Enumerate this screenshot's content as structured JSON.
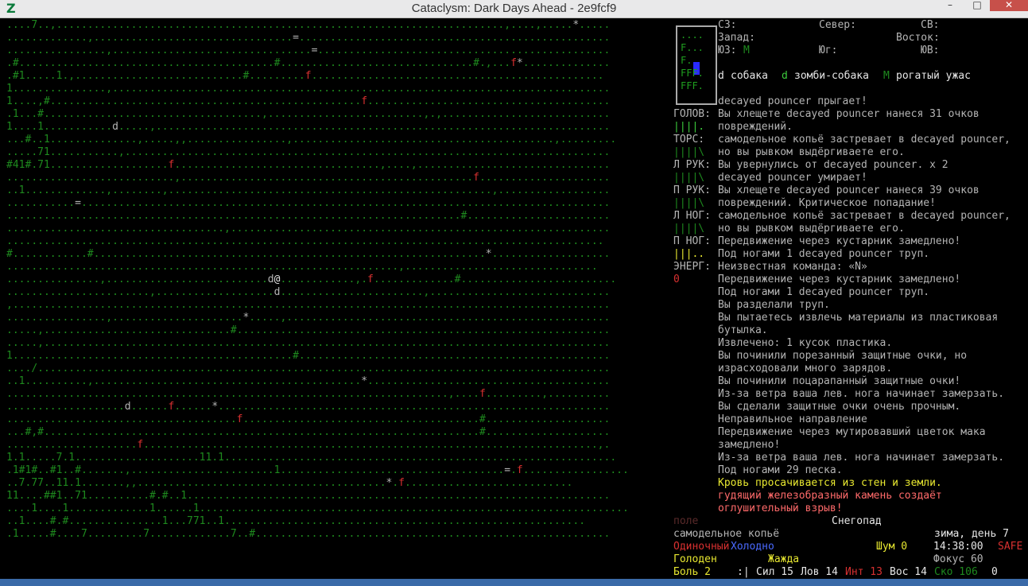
{
  "window": {
    "title": "Cataclysm: Dark Days Ahead - 2e9fcf9",
    "icon": "Z",
    "min": "–",
    "max": "□",
    "close": "✕"
  },
  "colors": {
    "dots": "#1e8a1e",
    "bright_green": "#3ccc3c",
    "red": "#d83030",
    "white": "#e6e6e6",
    "gray": "#b4b4b4",
    "yellow": "#e8e830",
    "blue": "#2a2aff",
    "pink": "#c86464"
  },
  "map": {
    "rows": [
      "....7..,........................................................................,....,.....*.....",
      ".............,................................=..................................................",
      "................,................................=...............................................",
      ".#.........................................#...............................#.,...f*..............",
      ".#1.....1.,...........................#.........f...............................................",
      "1...............,................................................................................",
      "1....,#..................................................f.......................................",
      ".1...#...................................,.........................,.,...........................",
      "1....1...........d.....,.........................................................................",
      "...#..1..............,.....,,................,..........................................,.........",
      ".....71...........,..............................................................................",
      "#41#.71...................f.................................,....,...............................",
      "...........................,...............................................f.....................",
      "..1.............,........,....................................................,..................",
      "...........=.....................................................................................",
      ".........................................................................#.......................",
      "...................................,.............................................................",
      "................................................................................................",
      "#............#...............................................................*...................",
      "...............................................................,...............................",
      "...............,..........................d@............,.f.............#.........................",
      ".......................,...................d.......................,.............................",
      ",................................................................................................",
      "................,.....................*.....,....................................................",
      ".....,..............................#............................................................",
      ".....,...........................................................................................",
      "1.............................................#..................................................",
      "..../............................................................................................",
      "..1..........,...........................................*.......................................",
      ".......................................................................,....f.........,..........",
      "...................d......f......*...............................................................",
      ".....................................f......................................#....................",
      "...#,#......................................................................#....................",
      ".....................f.........................................................................,.",
      "1.1.....7.1....................11.1...............................................................",
      ".1#1#..#1..#.......,.......................1....................................=.f.................",
      "..7.77..11.1.......,,........................................*.f...........................",
      "11....##1..71..........#.#..1....................................................................",
      "....1....1.............1......1.....................................................................",
      "..1....#.#...............1...771..1..........................................................",
      ".1.....#....7.........7.............7..#........................................................."
    ]
  },
  "minimap": {
    "rows": [
      "....",
      "F...",
      "F.",
      "FFF.",
      "FFF."
    ]
  },
  "compass": {
    "nw": "СЗ:",
    "n": "Север:",
    "ne": "СВ:",
    "w": "Запад:",
    "e": "Восток:",
    "sw": "ЮЗ:",
    "sw_val": "M",
    "s": "Юг:",
    "se": "ЮВ:"
  },
  "legend": [
    {
      "glyph": "d",
      "label": "собака",
      "color": "#e6e6e6"
    },
    {
      "glyph": "d",
      "label": "зомби-собака",
      "color": "#3ccc3c"
    },
    {
      "glyph": "M",
      "label": "рогатый ужас",
      "color": "#1e8a1e"
    }
  ],
  "body": [
    {
      "label": "ГОЛОВ:",
      "bar": "||||.",
      "color": "#3ccc3c"
    },
    {
      "label": "ТОРС:",
      "bar": "||||\\",
      "color": "#1e8a1e"
    },
    {
      "label": "Л РУК:",
      "bar": "||||\\",
      "color": "#1e8a1e"
    },
    {
      "label": "П РУК:",
      "bar": "||||\\",
      "color": "#1e8a1e"
    },
    {
      "label": "Л НОГ:",
      "bar": "||||\\",
      "color": "#1e8a1e"
    },
    {
      "label": "П НОГ:",
      "bar": "|||..",
      "color": "#e8e830"
    },
    {
      "label": "ЭНЕРГ:",
      "bar": "0",
      "color": "#d83030"
    }
  ],
  "log": [
    {
      "text": "decayed pouncer прыгает!",
      "color": "#b4b4b4"
    },
    {
      "text": "Вы хлещете decayed pouncer нанеся 31 очков",
      "color": "#b4b4b4"
    },
    {
      "text": "повреждений.",
      "color": "#b4b4b4"
    },
    {
      "text": "самодельное копьё застревает в decayed pouncer,",
      "color": "#b4b4b4"
    },
    {
      "text": "но вы рывком выдёргиваете его.",
      "color": "#b4b4b4"
    },
    {
      "text": "Вы увернулись от decayed pouncer. x 2",
      "color": "#b4b4b4"
    },
    {
      "text": "decayed pouncer умирает!",
      "color": "#b4b4b4"
    },
    {
      "text": "Вы хлещете decayed pouncer нанеся 39 очков",
      "color": "#b4b4b4"
    },
    {
      "text": "повреждений. Критическое попадание!",
      "color": "#b4b4b4"
    },
    {
      "text": "самодельное копьё застревает в decayed pouncer,",
      "color": "#b4b4b4"
    },
    {
      "text": "но вы рывком выдёргиваете его.",
      "color": "#b4b4b4"
    },
    {
      "text": "Передвижение через кустарник замедлено!",
      "color": "#b4b4b4"
    },
    {
      "text": "Под ногами 1 decayed pouncer труп.",
      "color": "#b4b4b4"
    },
    {
      "text": "Неизвестная команда: «N»",
      "color": "#b4b4b4"
    },
    {
      "text": "Передвижение через кустарник замедлено!",
      "color": "#b4b4b4"
    },
    {
      "text": "Под ногами 1 decayed pouncer труп.",
      "color": "#b4b4b4"
    },
    {
      "text": "Вы разделали труп.",
      "color": "#b4b4b4"
    },
    {
      "text": "Вы пытаетесь извлечь материалы из пластиковая",
      "color": "#b4b4b4"
    },
    {
      "text": "бутылка.",
      "color": "#b4b4b4"
    },
    {
      "text": "Извлечено: 1 кусок пластика.",
      "color": "#b4b4b4"
    },
    {
      "text": "Вы починили порезанный защитные очки, но",
      "color": "#b4b4b4"
    },
    {
      "text": "израсходовали много зарядов.",
      "color": "#b4b4b4"
    },
    {
      "text": "Вы починили поцарапанный защитные очки!",
      "color": "#b4b4b4"
    },
    {
      "text": "Из-за ветра ваша лев. нога начинает замерзать.",
      "color": "#b4b4b4"
    },
    {
      "text": "Вы сделали защитные очки очень прочным.",
      "color": "#b4b4b4"
    },
    {
      "text": "Неправильное направление",
      "color": "#b4b4b4"
    },
    {
      "text": "Передвижение через мутировавший цветок мака",
      "color": "#b4b4b4"
    },
    {
      "text": "замедлено!",
      "color": "#b4b4b4"
    },
    {
      "text": "Из-за ветра ваша лев. нога начинает замерзать.",
      "color": "#b4b4b4"
    },
    {
      "text": "Под ногами 29 песка.",
      "color": "#b4b4b4"
    },
    {
      "text": "Кровь просачивается из стен и земли.",
      "color": "#e8e830"
    },
    {
      "text": "гудящий железобразный камень создаёт",
      "color": "#ff6a6a"
    },
    {
      "text": "оглушительный взрыв!",
      "color": "#ff6a6a"
    }
  ],
  "status": {
    "terrain": "поле",
    "weather": "Снегопад",
    "weapon": "самодельное копьё",
    "season": "зима, день 7",
    "mode": "Одиночный",
    "temp": "Холодно",
    "noise": "Шум 0",
    "time": "14:38:00",
    "safe": "SAFE",
    "hunger": "Голоден",
    "thirst": "Жажда",
    "focus": "Фокус 60",
    "pain": "Боль 2",
    "face": ":|",
    "str": "Сил 15",
    "dex": "Лов 14",
    "int": "Инт 13",
    "per": "Вос 14",
    "speed": "Ско 106",
    "extra": "0"
  }
}
